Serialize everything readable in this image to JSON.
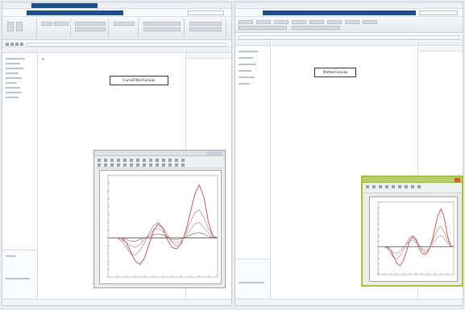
{
  "left_window": {
    "title": "",
    "annotation": "CurveFitterCanvas"
  },
  "right_window": {
    "title": "",
    "annotation": "PlotterCanvas"
  },
  "left_figure": {
    "chart_data": {
      "type": "line",
      "x": [
        0,
        0.5,
        1,
        1.5,
        2,
        2.5,
        3,
        3.5,
        4,
        4.5,
        5,
        5.5,
        6,
        6.5,
        7,
        7.5,
        8,
        8.5,
        9,
        9.5,
        10,
        10.5,
        11,
        11.5,
        12
      ],
      "series": [
        {
          "values": [
            0,
            0,
            0,
            0,
            -0.3,
            -0.9,
            -1.5,
            -1.7,
            -1.3,
            -0.4,
            0.5,
            0.9,
            0.6,
            -0.1,
            -0.6,
            -0.7,
            -0.4,
            0.4,
            1.6,
            2.8,
            3.4,
            2.6,
            1.0,
            0.1,
            0
          ]
        },
        {
          "values": [
            0,
            0,
            0,
            -0.2,
            -0.6,
            -1.0,
            -1.1,
            -0.8,
            -0.3,
            0.3,
            0.8,
            1.0,
            0.7,
            0.2,
            -0.3,
            -0.5,
            -0.3,
            0.3,
            1.0,
            1.6,
            1.8,
            1.3,
            0.6,
            0.1,
            0
          ]
        },
        {
          "values": [
            0,
            0,
            0,
            -0.1,
            -0.3,
            -0.5,
            -0.6,
            -0.4,
            -0.1,
            0.2,
            0.5,
            0.6,
            0.4,
            0.1,
            -0.2,
            -0.3,
            -0.2,
            0.1,
            0.5,
            0.9,
            1.0,
            0.7,
            0.3,
            0.05,
            0
          ]
        },
        {
          "values": [
            0,
            0,
            0,
            0,
            -0.1,
            -0.2,
            -0.2,
            -0.1,
            0,
            0.1,
            0.2,
            0.25,
            0.2,
            0.05,
            -0.1,
            -0.1,
            -0.05,
            0.05,
            0.2,
            0.3,
            0.35,
            0.25,
            0.1,
            0,
            0
          ]
        }
      ],
      "ylim": [
        -2.5,
        4
      ],
      "xlim": [
        0,
        12
      ],
      "grid": false
    }
  },
  "right_figure": {
    "chart_data": {
      "type": "line",
      "x": [
        0,
        0.5,
        1,
        1.5,
        2,
        2.5,
        3,
        3.5,
        4,
        4.5,
        5,
        5.5,
        6,
        6.5,
        7,
        7.5,
        8,
        8.5,
        9,
        9.5,
        10,
        10.5,
        11,
        11.5,
        12
      ],
      "series": [
        {
          "values": [
            0,
            0,
            0,
            0,
            -0.3,
            -0.9,
            -1.5,
            -1.7,
            -1.3,
            -0.4,
            0.5,
            0.9,
            0.6,
            -0.1,
            -0.6,
            -0.7,
            -0.4,
            0.4,
            1.6,
            2.8,
            3.4,
            2.6,
            1.0,
            0.1,
            0
          ]
        },
        {
          "values": [
            0,
            0,
            0,
            -0.2,
            -0.6,
            -1.0,
            -1.1,
            -0.8,
            -0.3,
            0.3,
            0.8,
            1.0,
            0.7,
            0.2,
            -0.3,
            -0.5,
            -0.3,
            0.3,
            1.0,
            1.6,
            1.8,
            1.3,
            0.6,
            0.1,
            0
          ]
        },
        {
          "values": [
            0,
            0,
            0,
            -0.1,
            -0.3,
            -0.5,
            -0.6,
            -0.4,
            -0.1,
            0.2,
            0.5,
            0.6,
            0.4,
            0.1,
            -0.2,
            -0.3,
            -0.2,
            0.1,
            0.5,
            0.9,
            1.0,
            0.7,
            0.3,
            0.05,
            0
          ]
        }
      ],
      "ylim": [
        -2.5,
        4
      ],
      "xlim": [
        0,
        12
      ],
      "grid": false
    }
  },
  "colors": {
    "title_accent": "#1e4f8c",
    "curve_colors": [
      "#c0504d",
      "#b07070",
      "#a08a8a",
      "#8a5050"
    ],
    "figure_frame_active": "#a5c142"
  }
}
